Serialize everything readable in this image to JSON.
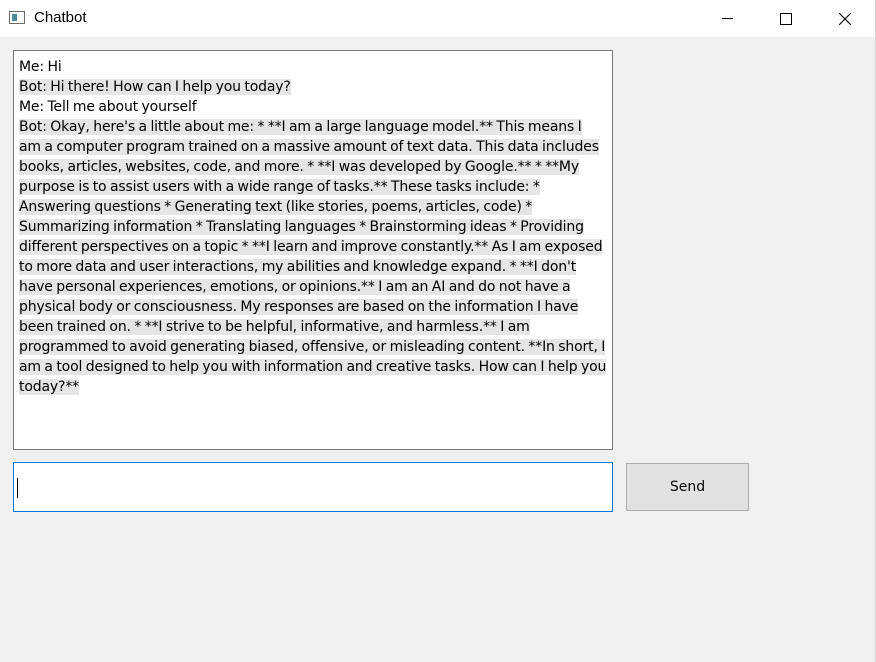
{
  "window": {
    "title": "Chatbot",
    "icon": "app-window-icon",
    "controls": [
      "minimize-icon",
      "maximize-icon",
      "close-icon"
    ]
  },
  "chat": {
    "messages": [
      {
        "sender": "me",
        "text": "Me: Hi"
      },
      {
        "sender": "bot",
        "text": "Bot: Hi there! How can I help you today? "
      },
      {
        "sender": "me",
        "text": "Me: Tell me about yourself"
      },
      {
        "sender": "bot",
        "text": "Bot: Okay, here's a little about me: * **I am a large language model.** This means I am a computer program trained on a massive amount of text data. This data includes books, articles, websites, code, and more. * **I was developed by Google.** * **My purpose is to assist users with a wide range of tasks.** These tasks include: * Answering questions * Generating text (like stories, poems, articles, code) * Summarizing information * Translating languages * Brainstorming ideas * Providing different perspectives on a topic * **I learn and improve constantly.** As I am exposed to more data and user interactions, my abilities and knowledge expand. * **I don't have personal experiences, emotions, or opinions.** I am an AI and do not have a physical body or consciousness. My responses are based on the information I have been trained on. * **I strive to be helpful, informative, and harmless.** I am programmed to avoid generating biased, offensive, or misleading content. **In short, I am a tool designed to help you with information and creative tasks. How can I help you today?**"
      }
    ]
  },
  "input": {
    "value": "",
    "focused": true
  },
  "send_button": {
    "label": "Send"
  },
  "colors": {
    "bot_highlight": "#e5e5e5",
    "focus_border": "#0078d7",
    "window_bg": "#f0f0f0"
  }
}
